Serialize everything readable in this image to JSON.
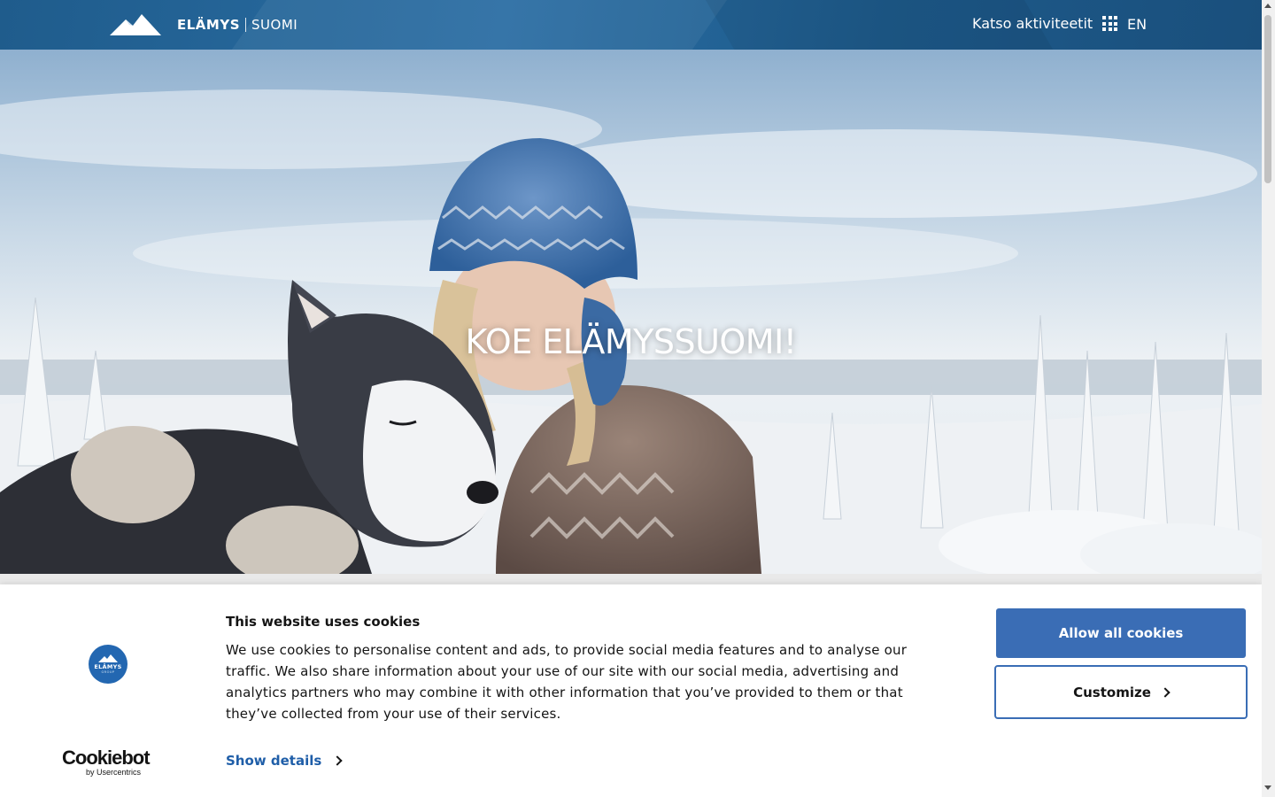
{
  "header": {
    "brand": "ELÄMYS",
    "brand_sub": "SUOMI",
    "activities_label": "Katso aktiviteetit",
    "activities_icon": "grid-icon",
    "language": "EN"
  },
  "hero": {
    "title": "KOE ELÄMYSSUOMI!"
  },
  "cookie_banner": {
    "logo_brand": "ELÄMYS",
    "logo_group": "GROUP",
    "title": "This website uses cookies",
    "text": "We use cookies to personalise content and ads, to provide social media features and to analyse our traffic. We also share information about your use of our site with our social media, advertising and analytics partners who may combine it with other information that you’ve provided to them or that they’ve collected from your use of their services.",
    "show_details": "Show details",
    "allow_all": "Allow all cookies",
    "customize": "Customize",
    "cookiebot_name": "Cookiebot",
    "cookiebot_by": "by Usercentrics"
  },
  "colors": {
    "header_blue": "#1f5c8c",
    "accent_blue": "#3a6db5",
    "link_blue": "#1f5ea8"
  }
}
